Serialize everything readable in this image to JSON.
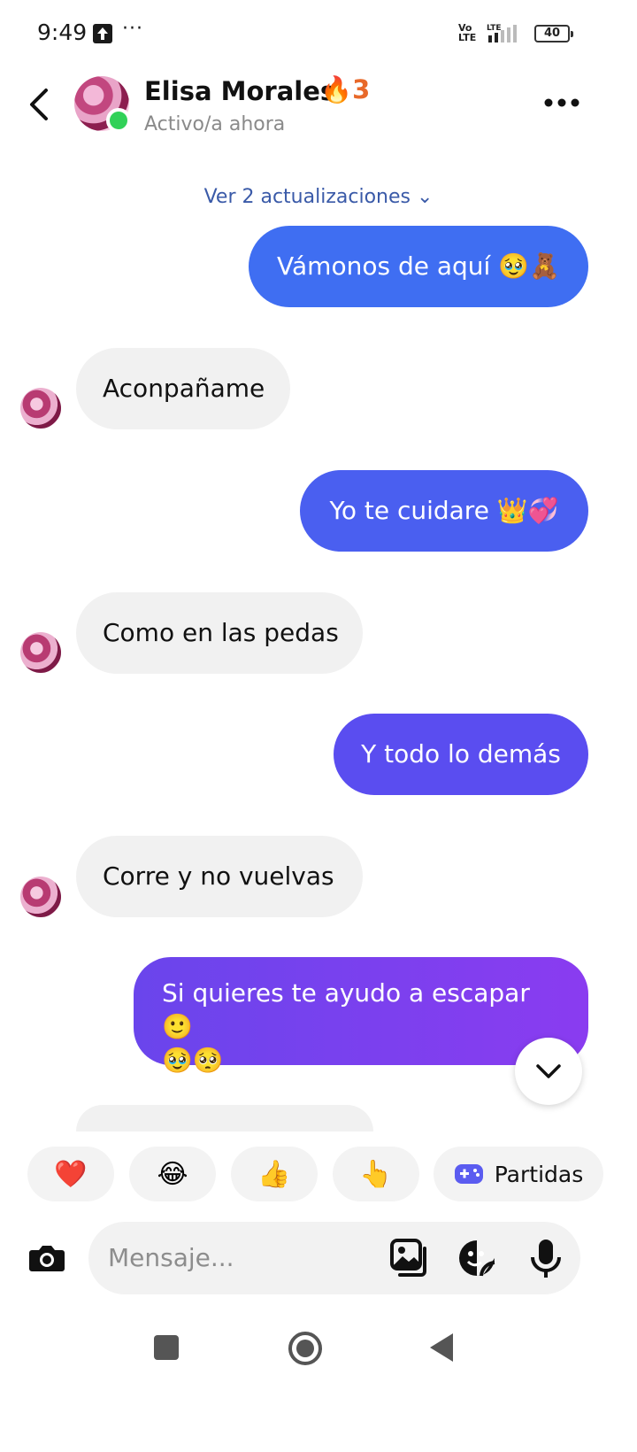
{
  "status_bar": {
    "time": "9:49",
    "more": "···",
    "volte": "Vo\nLTE",
    "lte": "LTE",
    "battery": "40"
  },
  "header": {
    "name": "Elisa Morales",
    "streak": "🔥3",
    "subtitle": "Activo/a ahora"
  },
  "updates_link": "Ver 2 actualizaciones ⌄",
  "messages": [
    {
      "from": "me",
      "text": "Vámonos de aquí 🥹🧸"
    },
    {
      "from": "them",
      "text": "Aconpañame"
    },
    {
      "from": "me",
      "text": "Yo te cuidare 👑💞"
    },
    {
      "from": "them",
      "text": "Como en las pedas"
    },
    {
      "from": "me",
      "text": "Y todo lo demás"
    },
    {
      "from": "them",
      "text": "Corre  y no vuelvas"
    },
    {
      "from": "me",
      "text": "Si quieres te ayudo a escapar 🙂\n🥹🥺"
    }
  ],
  "quick_replies": [
    {
      "icon": "❤️"
    },
    {
      "icon": "😂"
    },
    {
      "icon": "👍"
    },
    {
      "icon": "👆"
    },
    {
      "icon": "gamepad-icon",
      "label": "Partidas"
    }
  ],
  "composer": {
    "placeholder": "Mensaje..."
  },
  "colors": {
    "accent": "#3f6ef2",
    "online": "#31d158",
    "streak": "#e8692a",
    "link": "#3a5aa8"
  }
}
